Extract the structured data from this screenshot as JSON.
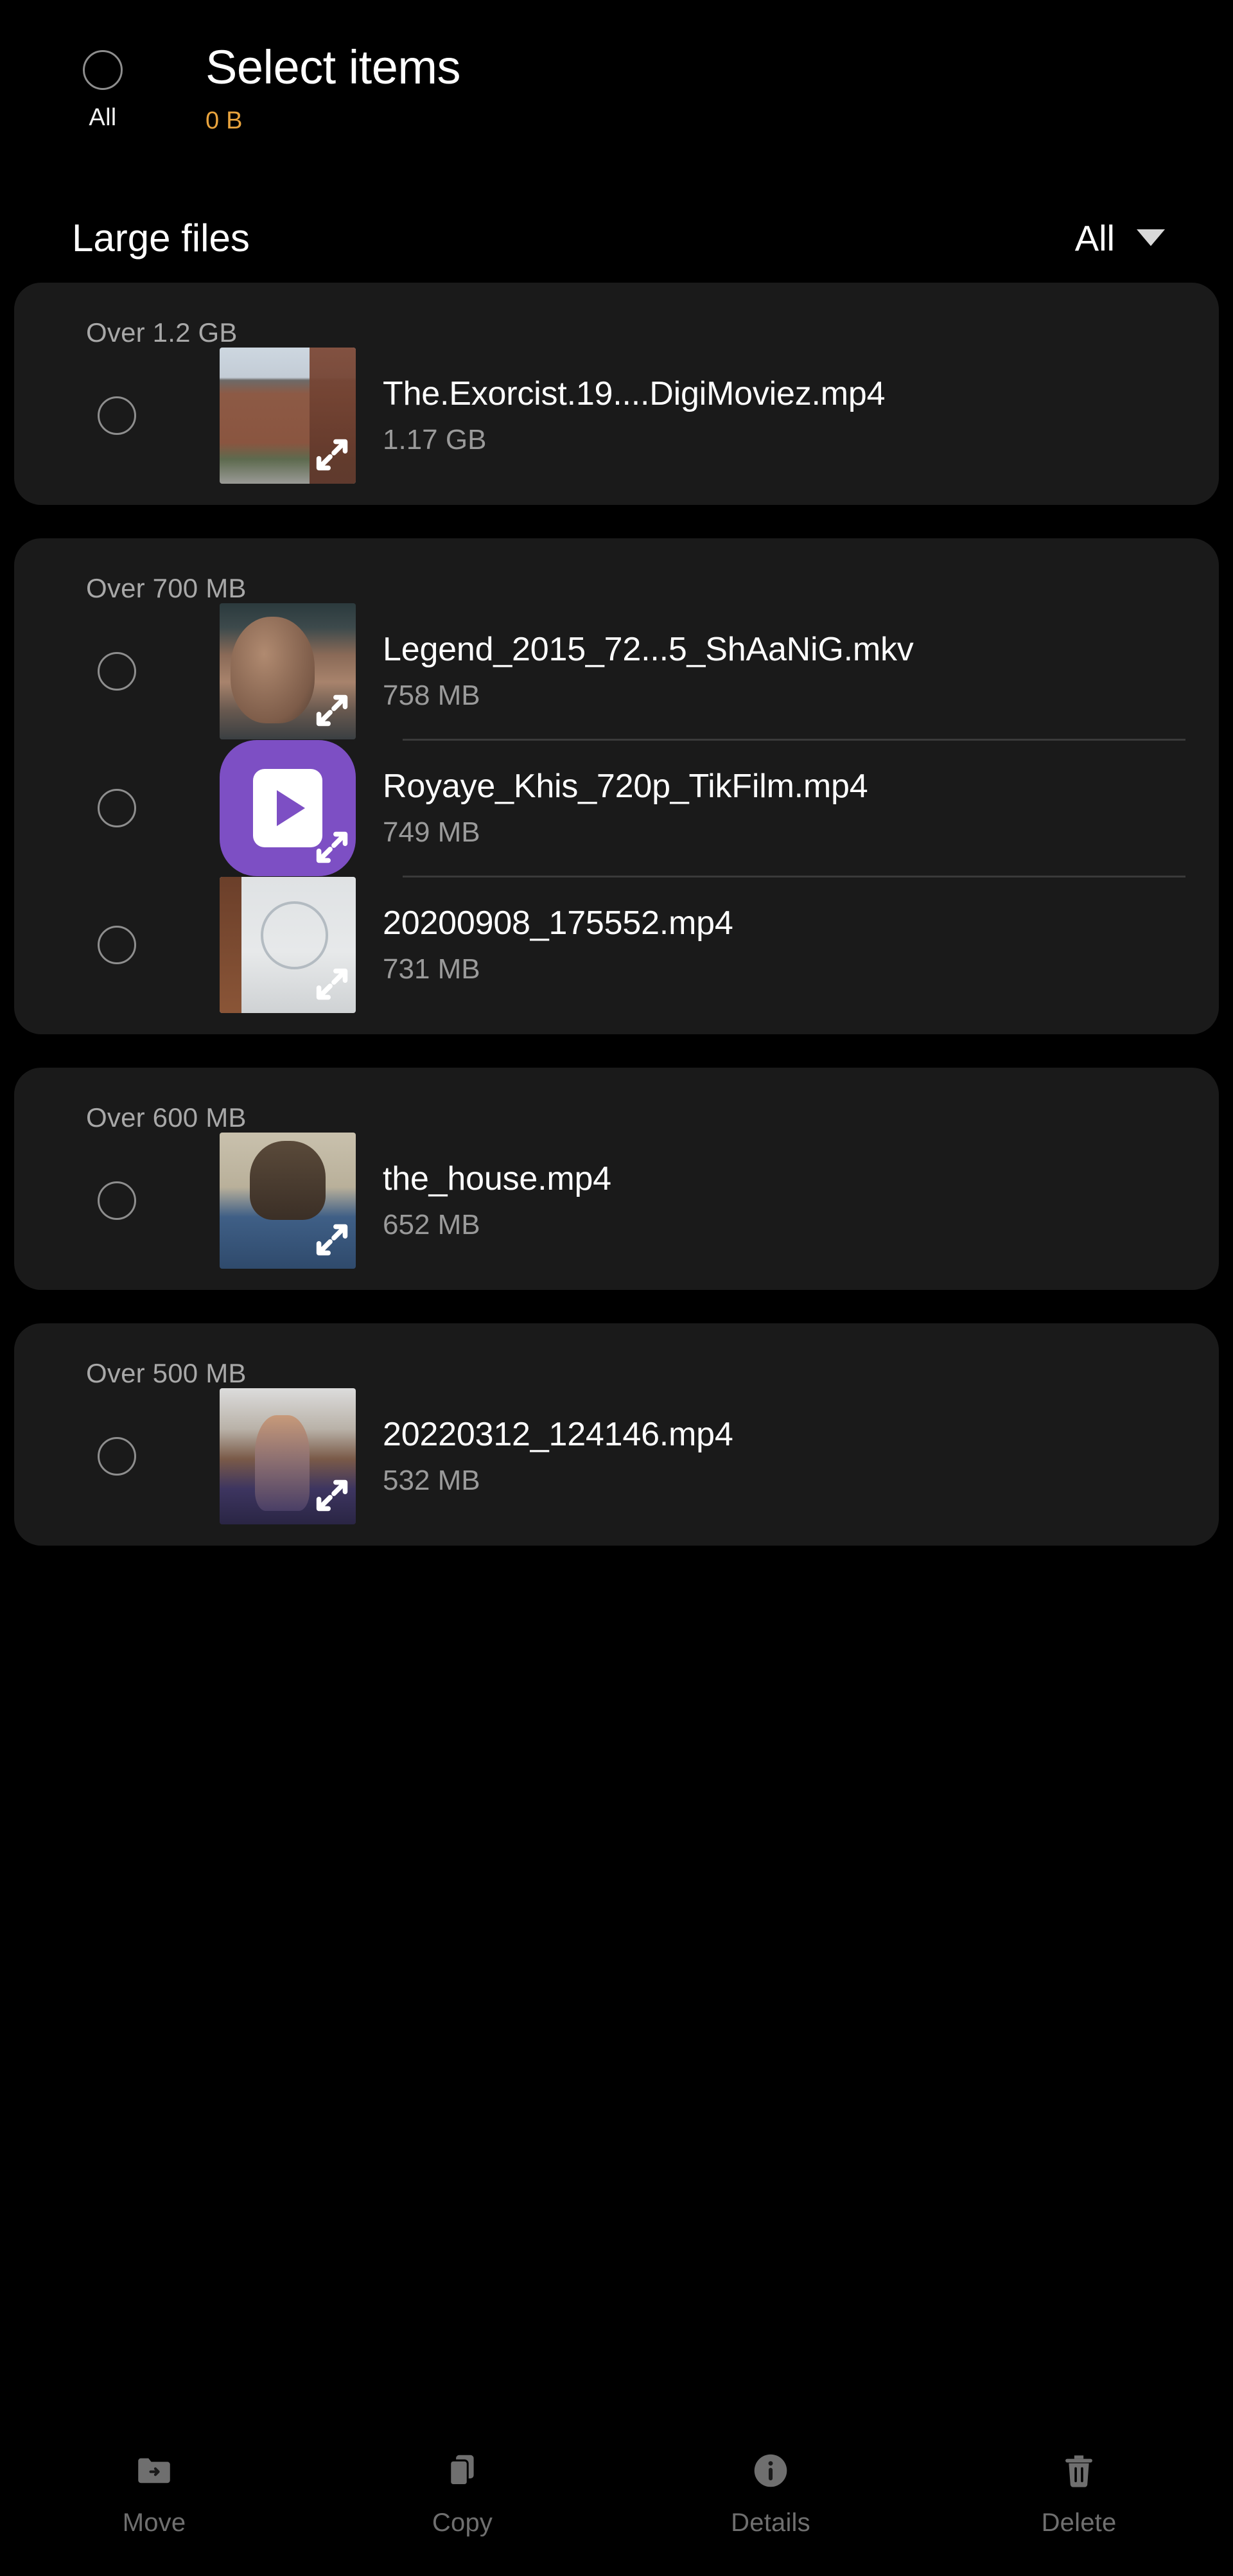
{
  "header": {
    "select_all_label": "All",
    "title": "Select items",
    "selected_size": "0 B"
  },
  "filter_bar": {
    "title": "Large files",
    "selected_filter": "All",
    "caret_icon": "chevron-down-icon"
  },
  "groups": [
    {
      "label": "Over 1.2 GB",
      "files": [
        {
          "name": "The.Exorcist.19....DigiMoviez.mp4",
          "size": "1.17 GB",
          "thumb": "th-exorcist",
          "icon_type": "image-thumbnail"
        }
      ]
    },
    {
      "label": "Over 700 MB",
      "files": [
        {
          "name": "Legend_2015_72...5_ShAaNiG.mkv",
          "size": "758 MB",
          "thumb": "th-legend",
          "icon_type": "image-thumbnail"
        },
        {
          "name": "Royaye_Khis_720p_TikFilm.mp4",
          "size": "749 MB",
          "thumb": "vid-icon",
          "icon_type": "video-app-icon"
        },
        {
          "name": "20200908_175552.mp4",
          "size": "731 MB",
          "thumb": "th-writing",
          "icon_type": "image-thumbnail"
        }
      ]
    },
    {
      "label": "Over 600 MB",
      "files": [
        {
          "name": "the_house.mp4",
          "size": "652 MB",
          "thumb": "th-cat",
          "icon_type": "image-thumbnail"
        }
      ]
    },
    {
      "label": "Over 500 MB",
      "files": [
        {
          "name": "20220312_124146.mp4",
          "size": "532 MB",
          "thumb": "th-gym",
          "icon_type": "image-thumbnail"
        }
      ]
    }
  ],
  "toolbar": [
    {
      "label": "Move",
      "icon": "folder-arrow-icon"
    },
    {
      "label": "Copy",
      "icon": "copy-sheets-icon"
    },
    {
      "label": "Details",
      "icon": "info-circle-icon"
    },
    {
      "label": "Delete",
      "icon": "trash-can-icon"
    }
  ],
  "colors": {
    "background": "#000000",
    "card": "#1a1a1a",
    "accent_size": "#e8a33d",
    "group_label": "#a8a8a8",
    "file_size": "#9a9a9a",
    "toolbar_disabled": "#6f6f6f",
    "video_icon_purple": "#7d4fc4"
  }
}
